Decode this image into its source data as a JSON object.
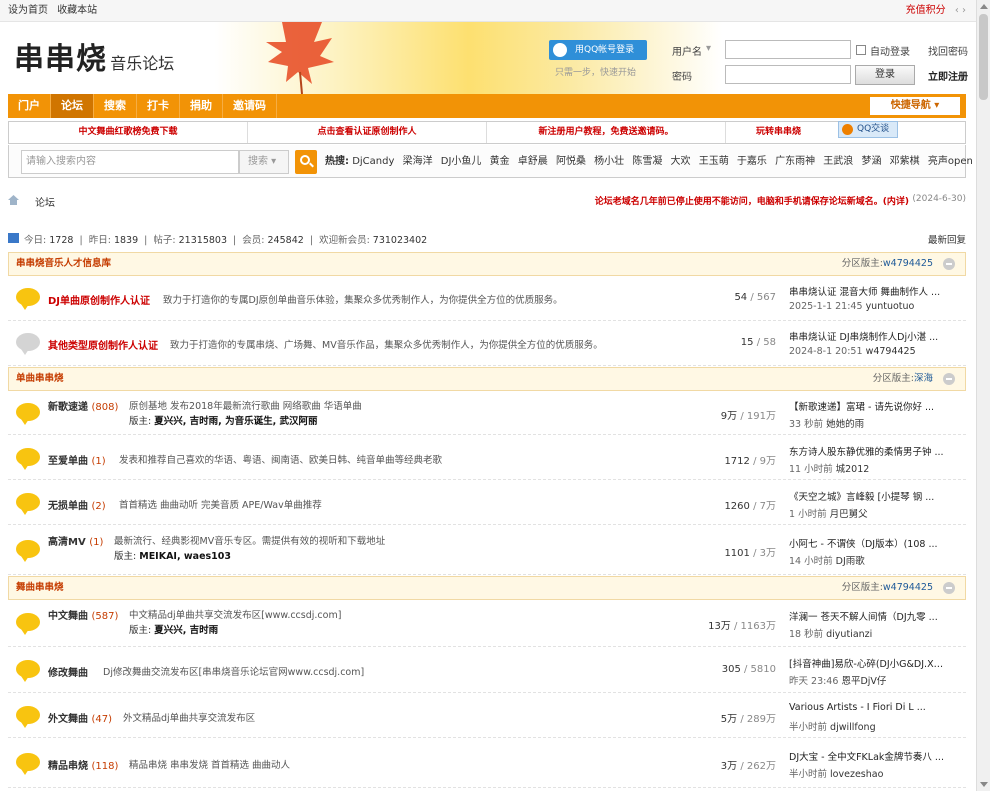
{
  "topbar": {
    "set_home": "设为首页",
    "bookmark": "收藏本站",
    "credit": "充值积分"
  },
  "header": {
    "logo_big": "串串烧",
    "logo_small": "音乐论坛",
    "qq_login": "用QQ帐号登录",
    "qq_hint": "只需一步，快速开始",
    "username_label": "用户名",
    "auto_login": "自动登录",
    "forgot": "找回密码",
    "password_label": "密码",
    "login_btn": "登录",
    "register": "立即注册"
  },
  "nav": {
    "items": [
      {
        "label": "门户"
      },
      {
        "label": "论坛"
      },
      {
        "label": "搜索"
      },
      {
        "label": "打卡"
      },
      {
        "label": "捐助"
      },
      {
        "label": "邀请码"
      }
    ],
    "quick": "快捷导航"
  },
  "links": [
    "中文舞曲红歌榜免费下载",
    "点击查看认证原创制作人",
    "新注册用户教程，免费送邀请码。",
    "玩转串串烧"
  ],
  "qq_talk": "QQ交谈",
  "search": {
    "placeholder": "请输入搜索内容",
    "type": "搜索",
    "hot_label": "热搜:",
    "hot": [
      "DjCandy",
      "梁海洋",
      "DJ小鱼儿",
      "黄金",
      "卓舒晨",
      "阿悦桑",
      "杨小壮",
      "陈雪凝",
      "大欢",
      "王玉萌",
      "于嘉乐",
      "广东雨神",
      "王武浪",
      "梦涵",
      "邓紫棋",
      "亮声open"
    ]
  },
  "breadcrumb": {
    "current": "论坛"
  },
  "notice": {
    "text": "论坛老域名几年前已停止使用不能访问，电脑和手机请保存论坛新域名。(内详)",
    "date": "(2024-6-30)"
  },
  "stats": {
    "today_label": "今日:",
    "today": "1728",
    "yesterday_label": "昨日:",
    "yesterday": "1839",
    "posts_label": "帖子:",
    "posts": "21315803",
    "members_label": "会员:",
    "members": "245842",
    "welcome_label": "欢迎新会员:",
    "newest": "731023402",
    "latest_reply": "最新回复"
  },
  "categories": [
    {
      "name": "串串烧音乐人才信息库",
      "mod_label": "分区版主:",
      "mod": "w4794425",
      "forums": [
        {
          "name": "DJ单曲原创制作人认证",
          "count": "",
          "desc": "致力于打造你的专属DJ原创单曲音乐体验，集聚众多优秀制作人，为你提供全方位的优质服务。",
          "mods": "",
          "threads": "54",
          "posts": "567",
          "last_title": "串串烧认证 混音大师 舞曲制作人 ...",
          "last_time": "2025-1-1 21:45",
          "last_user": "yuntuotuo",
          "icon": "yellow"
        },
        {
          "name": "其他类型原创制作人认证",
          "count": "",
          "desc": "致力于打造你的专属串烧、广场舞、MV音乐作品，集聚众多优秀制作人，为你提供全方位的优质服务。",
          "mods": "",
          "threads": "15",
          "posts": "58",
          "last_title": "串串烧认证 DJ串烧制作人Dj小湛 ...",
          "last_time": "2024-8-1 20:51",
          "last_user": "w4794425",
          "icon": "gray"
        }
      ]
    },
    {
      "name": "单曲串串烧",
      "mod_label": "分区版主:",
      "mod": "深海",
      "forums": [
        {
          "name": "新歌速递",
          "count": "(808)",
          "desc": "原创基地 发布2018年最新流行歌曲 网络歌曲 华语单曲",
          "mods_label": "版主:",
          "mods": "夏兴兴, 吉时雨, 为音乐诞生, 武汉阿丽",
          "threads": "9万",
          "posts": "191万",
          "last_title": "【新歌速递】富珺 - 请先说你好 ...",
          "last_time": "33 秒前",
          "last_user": "她她的雨",
          "icon": "yellow"
        },
        {
          "name": "至爱单曲",
          "count": "(1)",
          "desc": "发表和推荐自己喜欢的华语、粤语、闽南语、欧美日韩、纯音单曲等经典老歌",
          "mods": "",
          "threads": "1712",
          "posts": "9万",
          "last_title": "东方诗人股东静优雅的柔情男子钟 ...",
          "last_time": "11 小时前",
          "last_user": "城2012",
          "icon": "yellow"
        },
        {
          "name": "无损单曲",
          "count": "(2)",
          "desc": "首首精选 曲曲动听 完美音质 APE/Wav单曲推荐",
          "mods": "",
          "threads": "1260",
          "posts": "7万",
          "last_title": "《天空之城》言峰毅 [小提琴 钢 ...",
          "last_time": "1 小时前",
          "last_user": "月巴舅父",
          "icon": "yellow"
        },
        {
          "name": "高清MV",
          "count": "(1)",
          "desc": "最新流行、经典影视MV音乐专区。需提供有效的视听和下载地址",
          "mods_label": "版主:",
          "mods": "MEIKAI, waes103",
          "threads": "1101",
          "posts": "3万",
          "last_title": "小阿七 - 不谓侠（DJ版本）(108 ...",
          "last_time": "14 小时前",
          "last_user": "DJ雨歌",
          "icon": "yellow"
        }
      ]
    },
    {
      "name": "舞曲串串烧",
      "mod_label": "分区版主:",
      "mod": "w4794425",
      "forums": [
        {
          "name": "中文舞曲",
          "count": "(587)",
          "desc": "中文精品dj单曲共享交流发布区[www.ccsdj.com]",
          "mods_label": "版主:",
          "mods": "夏兴兴, 吉时雨",
          "threads": "13万",
          "posts": "1163万",
          "last_title": "洋澜一 苍天不解人间情（DJ九零 ...",
          "last_time": "18 秒前",
          "last_user": "diyutianzi",
          "icon": "yellow"
        },
        {
          "name": "修改舞曲",
          "count": "",
          "desc": "Dj修改舞曲交流发布区[串串烧音乐论坛官网www.ccsdj.com]",
          "mods": "",
          "threads": "305",
          "posts": "5810",
          "last_title": "[抖音神曲]易欣-心碎(DJ小G&DJ.X ...",
          "last_time": "昨天 23:46",
          "last_user": "恩平DjV仔",
          "icon": "yellow"
        },
        {
          "name": "外文舞曲",
          "count": "(47)",
          "desc": "外文精品dj单曲共享交流发布区",
          "mods": "",
          "threads": "5万",
          "posts": "289万",
          "last_title": "Various Artists - I Fiori Di L ...",
          "last_time": "半小时前",
          "last_user": "djwillfong",
          "icon": "yellow"
        },
        {
          "name": "精品串烧",
          "count": "(118)",
          "desc": "精品串烧 串串发烧 首首精选 曲曲动人",
          "mods": "",
          "threads": "3万",
          "posts": "262万",
          "last_title": "DJ大宝 - 全中文FKLak金牌节奏八 ...",
          "last_time": "半小时前",
          "last_user": "lovezeshao",
          "icon": "yellow"
        }
      ]
    }
  ]
}
